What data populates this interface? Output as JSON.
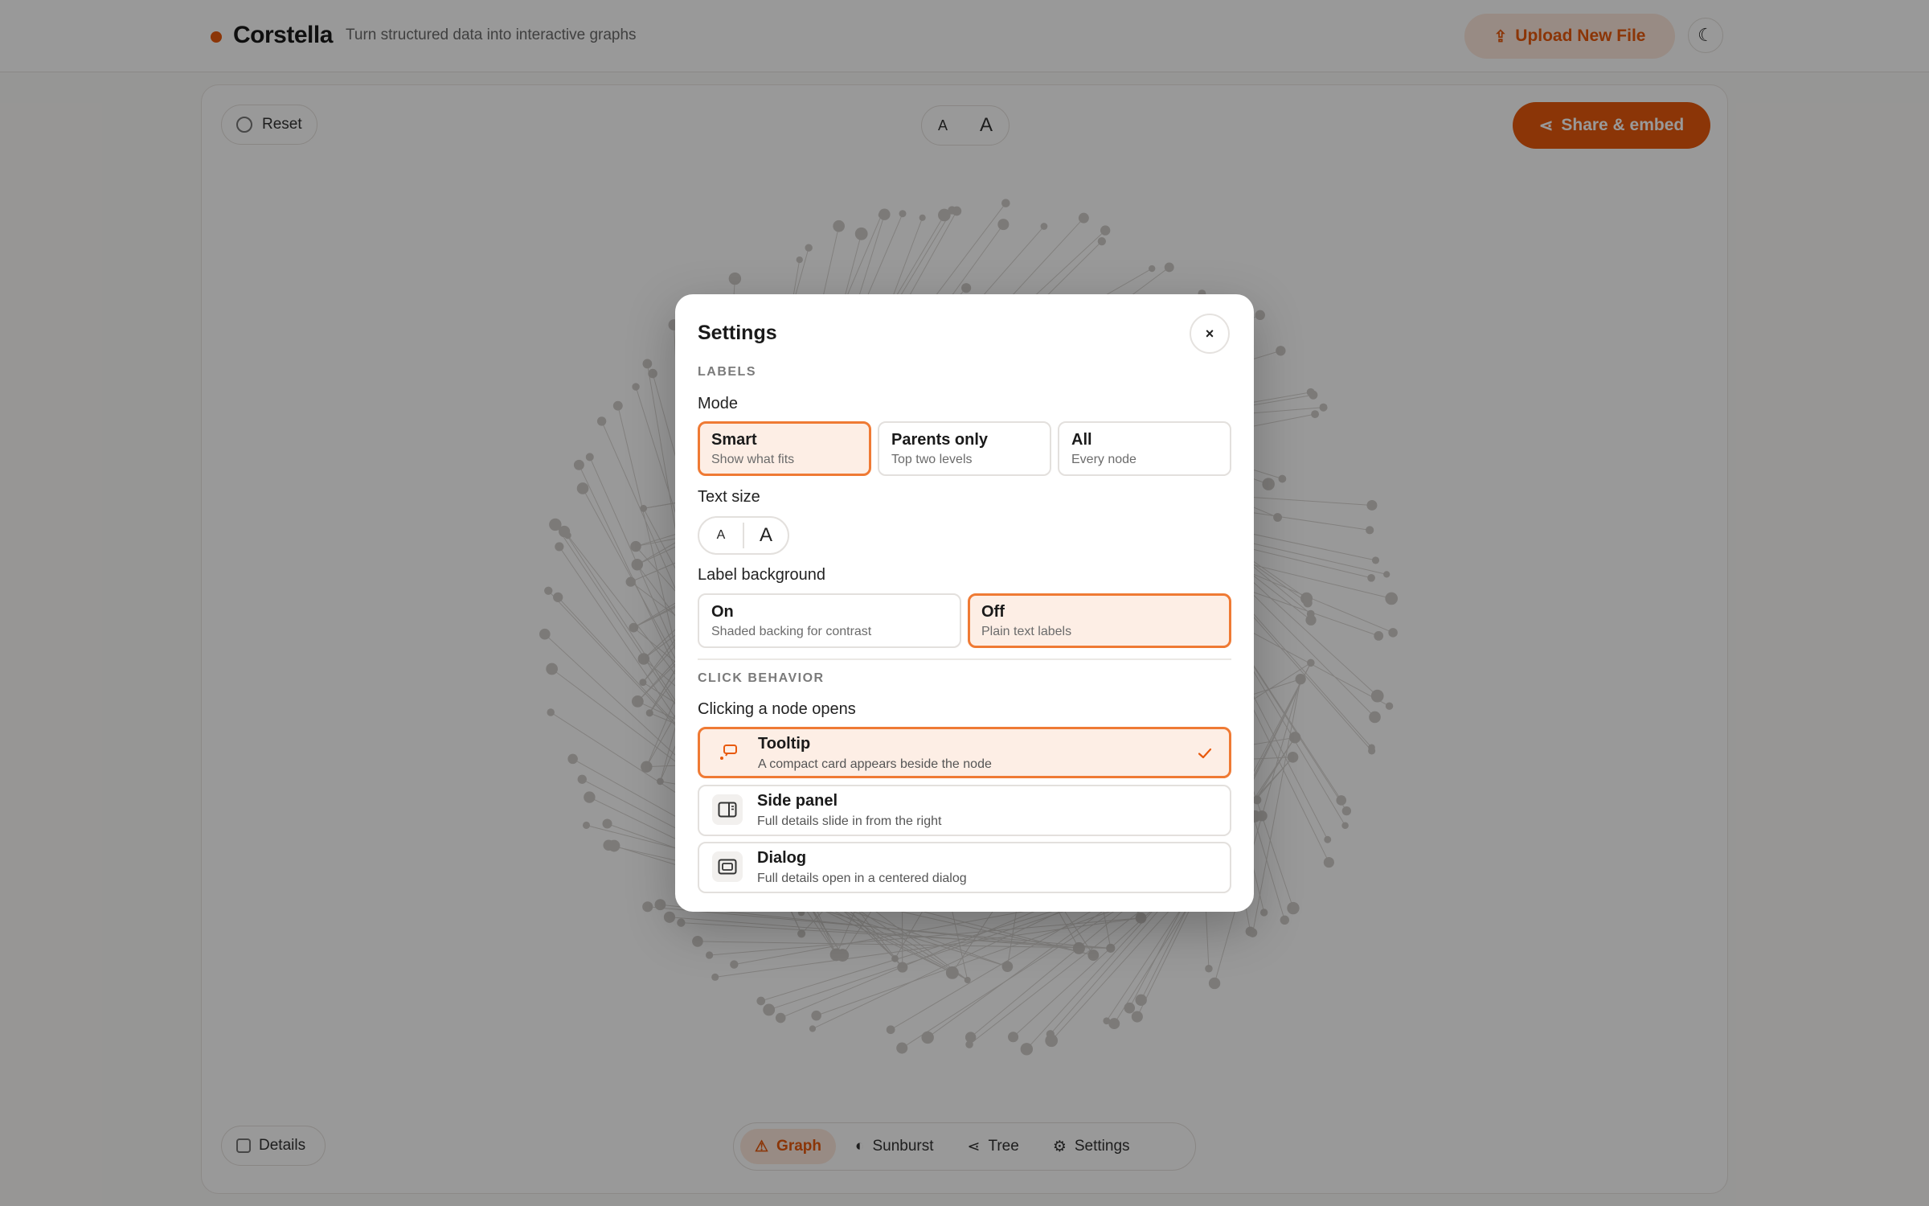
{
  "app": {
    "brand_name": "Corstella",
    "tagline": "Turn structured data into interactive graphs",
    "upload_label": "Upload New File",
    "theme_icon": "moon-icon",
    "accent_color": "#e8590c"
  },
  "canvas": {
    "reset_label": "Reset",
    "text_size_small": "A",
    "text_size_large": "A",
    "share_label": "Share & embed",
    "details_label": "Details"
  },
  "bottom_nav": {
    "items": [
      {
        "label": "Graph",
        "icon": "graph-icon",
        "active": true
      },
      {
        "label": "Sunburst",
        "icon": "sunburst-icon",
        "active": false
      },
      {
        "label": "Tree",
        "icon": "tree-icon",
        "active": false
      },
      {
        "label": "Settings",
        "icon": "gear-icon",
        "active": false
      }
    ]
  },
  "settings": {
    "title": "Settings",
    "close_label": "×",
    "labels_section": "LABELS",
    "mode_label": "Mode",
    "modes": [
      {
        "title": "Smart",
        "sub": "Show what fits",
        "selected": true
      },
      {
        "title": "Parents only",
        "sub": "Top two levels",
        "selected": false
      },
      {
        "title": "All",
        "sub": "Every node",
        "selected": false
      }
    ],
    "text_size_label": "Text size",
    "text_size_small": "A",
    "text_size_large": "A",
    "label_bg_label": "Label background",
    "label_bg_options": [
      {
        "title": "On",
        "sub": "Shaded backing for contrast",
        "selected": false
      },
      {
        "title": "Off",
        "sub": "Plain text labels",
        "selected": true
      }
    ],
    "click_section": "CLICK BEHAVIOR",
    "click_label": "Clicking a node opens",
    "click_options": [
      {
        "title": "Tooltip",
        "sub": "A compact card appears beside the node",
        "icon": "tooltip-icon",
        "selected": true
      },
      {
        "title": "Side panel",
        "sub": "Full details slide in from the right",
        "icon": "side-panel-icon",
        "selected": false
      },
      {
        "title": "Dialog",
        "sub": "Full details open in a centered dialog",
        "icon": "dialog-icon",
        "selected": false
      }
    ]
  }
}
